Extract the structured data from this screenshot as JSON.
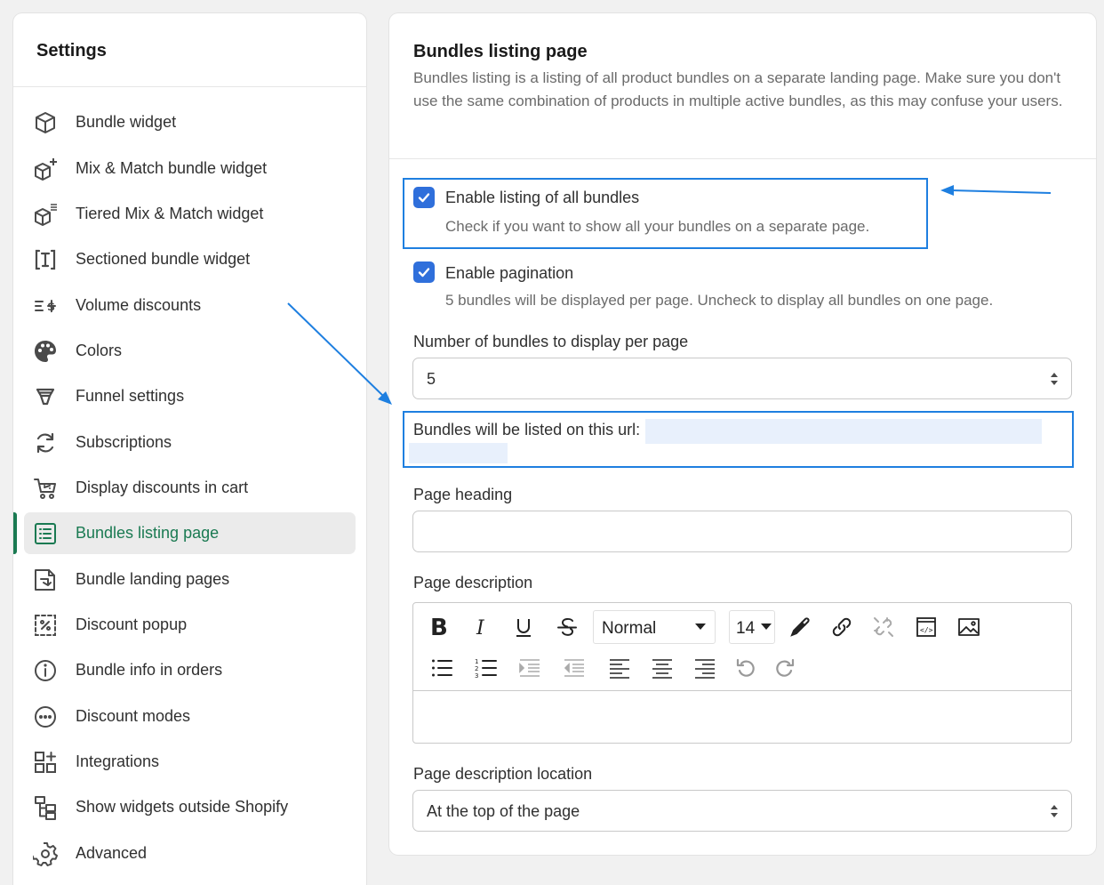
{
  "sidebar": {
    "title": "Settings",
    "items": [
      {
        "label": "Bundle widget",
        "icon": "cube-icon"
      },
      {
        "label": "Mix & Match bundle widget",
        "icon": "cube-plus-icon"
      },
      {
        "label": "Tiered Mix & Match widget",
        "icon": "cube-list-icon"
      },
      {
        "label": "Sectioned bundle widget",
        "icon": "sectioned-bracket-icon"
      },
      {
        "label": "Volume discounts",
        "icon": "volume-discount-icon"
      },
      {
        "label": "Colors",
        "icon": "palette-icon"
      },
      {
        "label": "Funnel settings",
        "icon": "funnel-icon"
      },
      {
        "label": "Subscriptions",
        "icon": "refresh-icon"
      },
      {
        "label": "Display discounts in cart",
        "icon": "cart-icon"
      },
      {
        "label": "Bundles listing page",
        "icon": "list-icon",
        "active": true
      },
      {
        "label": "Bundle landing pages",
        "icon": "landing-page-icon"
      },
      {
        "label": "Discount popup",
        "icon": "percent-popup-icon"
      },
      {
        "label": "Bundle info in orders",
        "icon": "info-icon"
      },
      {
        "label": "Discount modes",
        "icon": "dots-circle-icon"
      },
      {
        "label": "Integrations",
        "icon": "apps-plus-icon"
      },
      {
        "label": "Show widgets outside Shopify",
        "icon": "sitemap-icon"
      },
      {
        "label": "Advanced",
        "icon": "gear-icon"
      }
    ]
  },
  "main": {
    "title": "Bundles listing page",
    "description": "Bundles listing is a listing of all product bundles on a separate landing page. Make sure you don't use the same combination of products in multiple active bundles, as this may confuse your users.",
    "enable_listing": {
      "label": "Enable listing of all bundles",
      "help": "Check if you want to show all your bundles on a separate page.",
      "checked": true
    },
    "enable_pagination": {
      "label": "Enable pagination",
      "help": "5 bundles will be displayed per page. Uncheck to display all bundles on one page.",
      "checked": true
    },
    "per_page": {
      "label": "Number of bundles to display per page",
      "value": "5"
    },
    "url_text": "Bundles will be listed on this url:",
    "page_heading": {
      "label": "Page heading",
      "value": ""
    },
    "page_description": {
      "label": "Page description",
      "format_value": "Normal",
      "font_size": "14"
    },
    "description_location": {
      "label": "Page description location",
      "value": "At the top of the page"
    }
  },
  "colors": {
    "accent": "#1a7a52",
    "checkbox": "#2f6fdb",
    "highlight": "#1e7fe0"
  }
}
